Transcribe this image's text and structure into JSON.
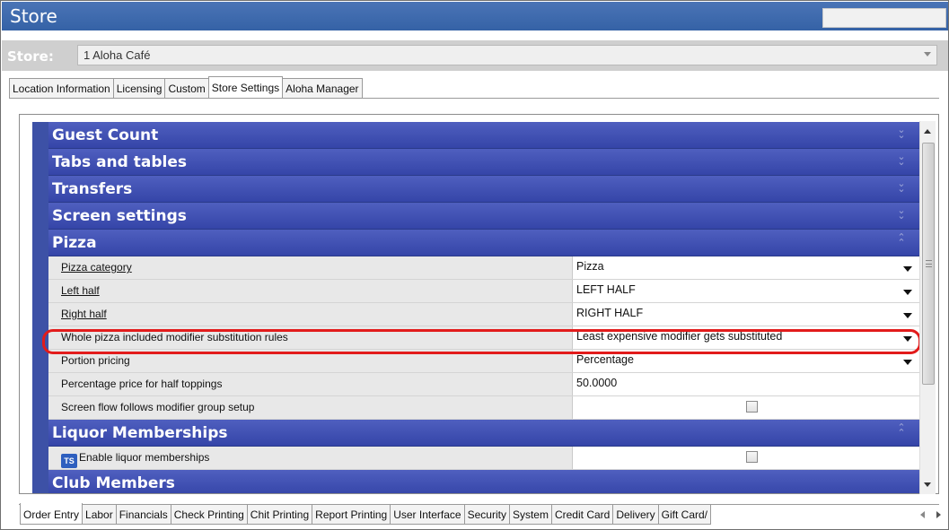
{
  "window": {
    "title": "Store"
  },
  "store": {
    "label": "Store:",
    "value": "1 Aloha Café"
  },
  "top_tabs": [
    {
      "label": "Location Information",
      "active": false
    },
    {
      "label": "Licensing",
      "active": false
    },
    {
      "label": "Custom",
      "active": false
    },
    {
      "label": "Store Settings",
      "active": true
    },
    {
      "label": "Aloha Manager",
      "active": false
    }
  ],
  "sections": {
    "guest_count": "Guest Count",
    "tabs_and_tables": "Tabs and tables",
    "transfers": "Transfers",
    "screen_settings": "Screen settings",
    "pizza": "Pizza",
    "liquor": "Liquor Memberships",
    "club": "Club Members"
  },
  "pizza_rows": [
    {
      "name": "Pizza category",
      "value": "Pizza",
      "type": "dropdown"
    },
    {
      "name": "Left half",
      "value": "LEFT HALF",
      "type": "dropdown"
    },
    {
      "name": "Right half",
      "value": "RIGHT HALF",
      "type": "dropdown"
    },
    {
      "name": "Whole pizza included modifier substitution rules",
      "value": "Least expensive modifier gets substituted",
      "type": "dropdown"
    },
    {
      "name": "Portion pricing",
      "value": "Percentage",
      "type": "dropdown"
    },
    {
      "name": "Percentage price for half toppings",
      "value": "50.0000",
      "type": "text"
    },
    {
      "name": "Screen flow follows modifier group setup",
      "value": "",
      "type": "checkbox",
      "checked": false
    }
  ],
  "liquor_rows": [
    {
      "name": "Enable liquor memberships",
      "icon": "TS",
      "type": "checkbox",
      "checked": false
    }
  ],
  "bottom_tabs": [
    {
      "label": "Order Entry",
      "active": true
    },
    {
      "label": "Labor",
      "active": false
    },
    {
      "label": "Financials",
      "active": false
    },
    {
      "label": "Check Printing",
      "active": false
    },
    {
      "label": "Chit Printing",
      "active": false
    },
    {
      "label": "Report Printing",
      "active": false
    },
    {
      "label": "User Interface",
      "active": false
    },
    {
      "label": "Security",
      "active": false
    },
    {
      "label": "System",
      "active": false
    },
    {
      "label": "Credit Card",
      "active": false
    },
    {
      "label": "Delivery",
      "active": false
    },
    {
      "label": "Gift Card/",
      "active": false
    }
  ],
  "colors": {
    "title_bar": "#3f6aae",
    "section_header": "#3d4fb0",
    "highlight": "#e21b1b"
  }
}
